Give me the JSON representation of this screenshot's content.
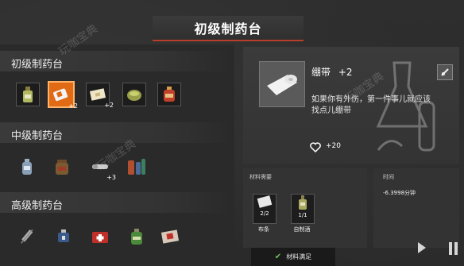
{
  "header": {
    "title": "初级制药台"
  },
  "sections": [
    {
      "title": "初级制药台",
      "items": [
        {
          "icon": "bottle-icon",
          "boxed": true
        },
        {
          "icon": "bandage-icon",
          "selected": true,
          "badge": "+2"
        },
        {
          "icon": "gauze-icon",
          "boxed": true,
          "badge": "+2"
        },
        {
          "icon": "herb-bowl-icon",
          "boxed": true
        },
        {
          "icon": "potion-icon",
          "boxed": true
        }
      ]
    },
    {
      "title": "中级制药台",
      "items": [
        {
          "icon": "flask-icon"
        },
        {
          "icon": "jar-icon"
        },
        {
          "icon": "splint-icon",
          "badge": "+3"
        },
        {
          "icon": "vials-icon"
        }
      ]
    },
    {
      "title": "高级制药台",
      "items": [
        {
          "icon": "syringe-icon"
        },
        {
          "icon": "medkit-small-icon"
        },
        {
          "icon": "first-aid-kit-icon"
        },
        {
          "icon": "green-potion-icon"
        },
        {
          "icon": "med-pack-icon"
        }
      ]
    }
  ],
  "detail": {
    "name": "绷带",
    "count": "+2",
    "description": "如果你有外伤，第一件事儿就应该找点儿绷带",
    "health_value": "+20"
  },
  "materials": {
    "title": "材料需要",
    "items": [
      {
        "count": "2/2",
        "label": "布条",
        "icon": "cloth-icon"
      },
      {
        "count": "1/1",
        "label": "自制酒",
        "icon": "alcohol-bottle-icon"
      }
    ]
  },
  "time": {
    "title": "时间",
    "value": "-6.3998分钟"
  },
  "confirm": {
    "label": "材料满足"
  },
  "watermark": {
    "text": "玩咖宝典"
  },
  "colors": {
    "accent": "#e06b14",
    "header_underline": "#b8402a",
    "check": "#6fc25a"
  }
}
